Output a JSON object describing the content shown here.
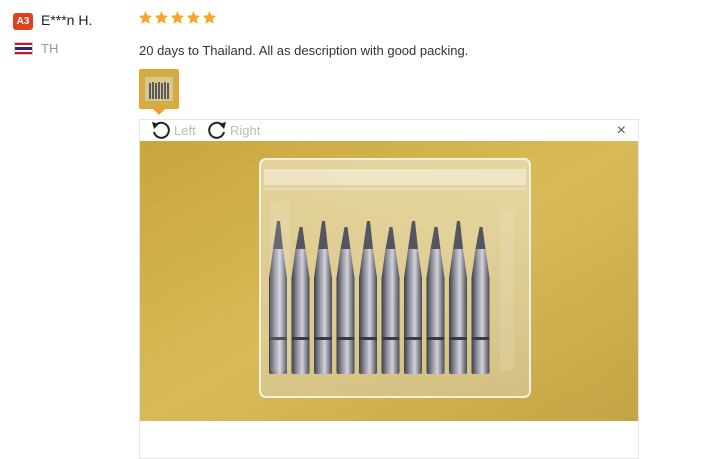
{
  "review": {
    "badge": "A3",
    "username": "E***n H.",
    "country_code": "TH",
    "rating": 5,
    "star_color": "#f5a623",
    "comment": "20 days to Thailand. All as description with good packing."
  },
  "viewer": {
    "rotate_left_label": "Left",
    "rotate_right_label": "Right",
    "close_symbol": "×",
    "accent": "#f0a030"
  },
  "icons": [
    "user-level-badge",
    "thailand-flag-icon",
    "star-icon",
    "rotate-left-icon",
    "rotate-right-icon",
    "close-icon"
  ]
}
